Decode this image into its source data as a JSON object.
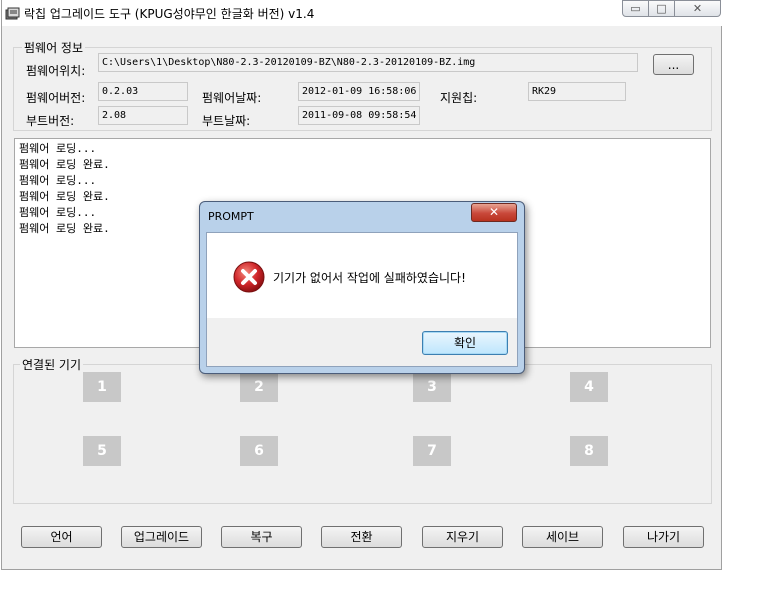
{
  "window": {
    "title": "락칩 업그레이드 도구 (KPUG성야무인 한글화 버전) v1.4",
    "controls": {
      "minimize": "▭",
      "maximize": "□",
      "close": "✕"
    }
  },
  "firmware_info": {
    "group_label": "펌웨어 정보",
    "location_label": "펌웨어위치:",
    "location_value": "C:\\Users\\1\\Desktop\\N80-2.3-20120109-BZ\\N80-2.3-20120109-BZ.img",
    "browse_button": "...",
    "fw_version_label": "펌웨어버전:",
    "fw_version_value": "0.2.03",
    "fw_date_label": "펌웨어날짜:",
    "fw_date_value": "2012-01-09 16:58:06",
    "chip_label": "지원칩:",
    "chip_value": "RK29",
    "boot_version_label": "부트버전:",
    "boot_version_value": "2.08",
    "boot_date_label": "부트날짜:",
    "boot_date_value": "2011-09-08 09:58:54"
  },
  "log_lines": [
    "펌웨어 로딩...",
    "펌웨어 로딩 완료.",
    "펌웨어 로딩...",
    "펌웨어 로딩 완료.",
    "펌웨어 로딩...",
    "펌웨어 로딩 완료."
  ],
  "connected_devices": {
    "group_label": "연결된 기기",
    "slots": [
      "1",
      "2",
      "3",
      "4",
      "5",
      "6",
      "7",
      "8"
    ]
  },
  "bottom_buttons": [
    "언어",
    "업그레이드",
    "복구",
    "전환",
    "지우기",
    "세이브",
    "나가기"
  ],
  "dialog": {
    "title": "PROMPT",
    "close": "✕",
    "message": "기기가 없어서 작업에 실패하였습니다!",
    "ok_button": "확인",
    "icon": "error-icon"
  },
  "colors": {
    "window_bg": "#f0f0f0",
    "dialog_frame": "#b9d1ea",
    "close_red": "#c9483a",
    "device_slot": "#c8c8c8"
  }
}
